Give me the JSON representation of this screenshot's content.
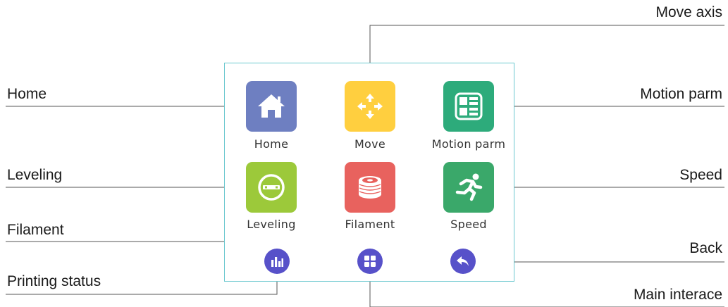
{
  "callouts": {
    "move_axis": "Move axis",
    "home": "Home",
    "motion_parm": "Motion parm",
    "leveling": "Leveling",
    "speed": "Speed",
    "filament": "Filament",
    "back": "Back",
    "printing_status": "Printing status",
    "main_interface": "Main interace"
  },
  "screen": {
    "tiles": [
      {
        "label": "Home",
        "icon": "house-icon",
        "color": "#6e7fc1"
      },
      {
        "label": "Move",
        "icon": "move-arrows-icon",
        "color": "#ffcf3f"
      },
      {
        "label": "Motion parm",
        "icon": "motion-params-icon",
        "color": "#2dab7b"
      },
      {
        "label": "Leveling",
        "icon": "level-icon",
        "color": "#9cc93a"
      },
      {
        "label": "Filament",
        "icon": "filament-spool-icon",
        "color": "#e8625e"
      },
      {
        "label": "Speed",
        "icon": "running-man-icon",
        "color": "#3aa86a"
      }
    ],
    "bottom_buttons": [
      {
        "icon": "bar-chart-icon",
        "color": "#5751c9"
      },
      {
        "icon": "grid-icon",
        "color": "#5751c9"
      },
      {
        "icon": "back-arrow-icon",
        "color": "#5751c9"
      }
    ],
    "border_color": "#6cc8cf"
  }
}
